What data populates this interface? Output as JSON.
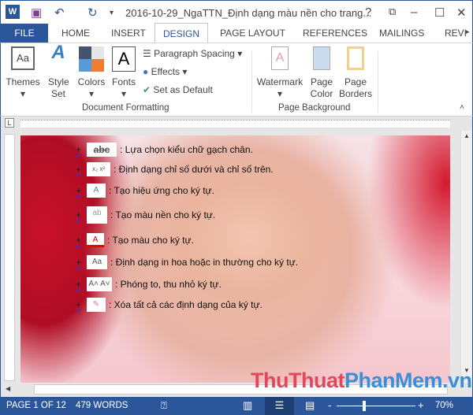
{
  "window": {
    "title": "2016-10-29_NgaTTN_Định dạng màu nền cho trang...",
    "help": "?",
    "minimize": "–",
    "maximize": "☐",
    "close": "✕"
  },
  "tabs": {
    "file": "FILE",
    "home": "HOME",
    "insert": "INSERT",
    "design": "DESIGN",
    "page_layout": "PAGE LAYOUT",
    "references": "REFERENCES",
    "mailings": "MAILINGS",
    "review": "REVI"
  },
  "ribbon": {
    "themes": "Themes",
    "style_set": "Style Set",
    "colors": "Colors",
    "fonts": "Fonts",
    "paragraph_spacing": "Paragraph Spacing",
    "effects": "Effects",
    "set_default": "Set as Default",
    "group_doc": "Document Formatting",
    "watermark": "Watermark",
    "page_color": "Page Color",
    "page_borders": "Page Borders",
    "group_bg": "Page Background"
  },
  "document": {
    "items": [
      {
        "icon": "abc",
        "text": ": Lựa chọn kiểu chữ gạch chân."
      },
      {
        "icon": "x₂ x²",
        "text": ": Định dạng chỉ số dưới và chỉ số trên."
      },
      {
        "icon": "A",
        "text": ": Tạo hiệu ứng cho ký tự."
      },
      {
        "icon": "ab",
        "text": ": Tạo màu nền cho ký tự."
      },
      {
        "icon": "A",
        "text": ": Tạo màu cho ký tự."
      },
      {
        "icon": "Aa",
        "text": ": Định dạng in hoa hoặc in thường cho ký tự."
      },
      {
        "icon": "A˄ A˅",
        "text": ": Phóng to, thu nhỏ ký tự."
      },
      {
        "icon": "✎",
        "text": ": Xóa tất cả các định dạng của ký tự."
      }
    ]
  },
  "watermark_text": {
    "part1": "ThuThuat",
    "part2": "PhanMem.vn"
  },
  "status": {
    "page": "PAGE 1 OF 12",
    "words": "479 WORDS",
    "zoom": "70%",
    "zoom_percent": 70
  },
  "colors": {
    "accent": "#2b579a"
  }
}
